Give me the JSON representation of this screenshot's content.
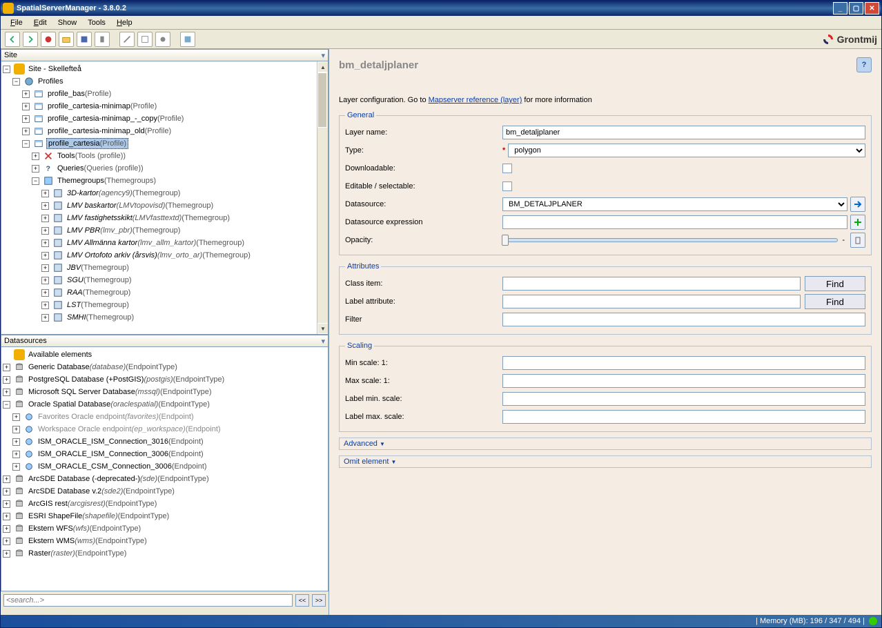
{
  "window": {
    "title": "SpatialServerManager - 3.8.0.2"
  },
  "menu": {
    "file": "File",
    "edit": "Edit",
    "show": "Show",
    "tools": "Tools",
    "help": "Help"
  },
  "brand": "Grontmij",
  "panels": {
    "site": "Site",
    "ds": "Datasources"
  },
  "siteTree": {
    "root": {
      "label": "Site - Skellefteå"
    },
    "profiles": "Profiles",
    "p_bas": {
      "label": "profile_bas",
      "type": "(Profile)"
    },
    "p_cm": {
      "label": "profile_cartesia-minimap",
      "type": "(Profile)"
    },
    "p_cmc": {
      "label": "profile_cartesia-minimap_-_copy",
      "type": "(Profile)"
    },
    "p_cmo": {
      "label": "profile_cartesia-minimap_old",
      "type": "(Profile)"
    },
    "p_c": {
      "label": "profile_cartesia",
      "type": "(Profile)"
    },
    "tools": {
      "label": "Tools",
      "type": "(Tools (profile))"
    },
    "queries": {
      "label": "Queries",
      "type": "(Queries (profile))"
    },
    "tg": {
      "label": "Themegroups",
      "type": "(Themegroups)"
    },
    "tg_3d": {
      "label": "3D-kartor",
      "sub": "(agency9)",
      "type": "(Themegroup)"
    },
    "tg_bas": {
      "label": "LMV baskartor",
      "sub": "(LMVtopovisd)",
      "type": "(Themegroup)"
    },
    "tg_fast": {
      "label": "LMV fastighetsskikt",
      "sub": "(LMVfasttextd)",
      "type": "(Themegroup)"
    },
    "tg_pbr": {
      "label": "LMV PBR",
      "sub": "(lmv_pbr)",
      "type": "(Themegroup)"
    },
    "tg_allm": {
      "label": "LMV Allmänna kartor",
      "sub": "(lmv_allm_kartor)",
      "type": "(Themegroup)"
    },
    "tg_orto": {
      "label": "LMV Ortofoto arkiv (årsvis)",
      "sub": "(lmv_orto_ar)",
      "type": "(Themegroup)"
    },
    "tg_jbv": {
      "label": "JBV",
      "type": "(Themegroup)"
    },
    "tg_sgu": {
      "label": "SGU",
      "type": "(Themegroup)"
    },
    "tg_raa": {
      "label": "RAA",
      "type": "(Themegroup)"
    },
    "tg_lst": {
      "label": "LST",
      "type": "(Themegroup)"
    },
    "tg_smhi": {
      "label": "SMHI",
      "type": "(Themegroup)"
    }
  },
  "dsTree": {
    "avail": "Available elements",
    "generic": {
      "label": "Generic Database",
      "sub": "(database)",
      "type": "(EndpointType)"
    },
    "pg": {
      "label": "PostgreSQL Database (+PostGIS)",
      "sub": "(postgis)",
      "type": "(EndpointType)"
    },
    "mssql": {
      "label": "Microsoft SQL Server Database",
      "sub": "(mssql)",
      "type": "(EndpointType)"
    },
    "ora": {
      "label": "Oracle Spatial Database",
      "sub": "(oraclespatial)",
      "type": "(EndpointType)"
    },
    "fav": {
      "label": "Favorites Oracle endpoint",
      "sub": "(favorites)",
      "type": "(Endpoint)"
    },
    "ws": {
      "label": "Workspace Oracle endpoint",
      "sub": "(ep_workspace)",
      "type": "(Endpoint)"
    },
    "c3016": {
      "label": "ISM_ORACLE_ISM_Connection_3016",
      "type": "(Endpoint)"
    },
    "c3006": {
      "label": "ISM_ORACLE_ISM_Connection_3006",
      "type": "(Endpoint)"
    },
    "csm3006": {
      "label": "ISM_ORACLE_CSM_Connection_3006",
      "type": "(Endpoint)"
    },
    "sde": {
      "label": "ArcSDE Database (-deprecated-)",
      "sub": "(sde)",
      "type": "(EndpointType)"
    },
    "sde2": {
      "label": "ArcSDE Database v.2",
      "sub": "(sde2)",
      "type": "(EndpointType)"
    },
    "arcgis": {
      "label": "ArcGIS rest",
      "sub": "(arcgisrest)",
      "type": "(EndpointType)"
    },
    "shape": {
      "label": "ESRI ShapeFile",
      "sub": "(shapefile)",
      "type": "(EndpointType)"
    },
    "wfs": {
      "label": "Ekstern WFS",
      "sub": "(wfs)",
      "type": "(EndpointType)"
    },
    "wms": {
      "label": "Ekstern WMS",
      "sub": "(wms)",
      "type": "(EndpointType)"
    },
    "raster": {
      "label": "Raster",
      "sub": "(raster)",
      "type": "(EndpointType)"
    }
  },
  "search": {
    "placeholder": "<search...>",
    "prev": "<<",
    "next": ">>"
  },
  "detail": {
    "title": "bm_detaljplaner",
    "subPre": "Layer configuration. Go to ",
    "subLink": "Mapserver reference (layer)",
    "subPost": " for more information",
    "general": {
      "legend": "General",
      "layerName_l": "Layer name:",
      "layerName": "bm_detaljplaner",
      "type_l": "Type:",
      "type": "polygon",
      "downloadable_l": "Downloadable:",
      "editsel_l": "Editable / selectable:",
      "datasource_l": "Datasource:",
      "datasource": "BM_DETALJPLANER",
      "dsexpr_l": "Datasource expression",
      "opacity_l": "Opacity:",
      "opacity_dash": "-"
    },
    "attributes": {
      "legend": "Attributes",
      "classitem_l": "Class item:",
      "labelattr_l": "Label attribute:",
      "filter_l": "Filter",
      "find": "Find"
    },
    "scaling": {
      "legend": "Scaling",
      "min_l": "Min scale: 1:",
      "max_l": "Max scale: 1:",
      "lmin_l": "Label min. scale:",
      "lmax_l": "Label max. scale:"
    },
    "advanced": "Advanced",
    "omit": "Omit element"
  },
  "status": {
    "mem": "| Memory (MB): 196 / 347 / 494 |"
  }
}
